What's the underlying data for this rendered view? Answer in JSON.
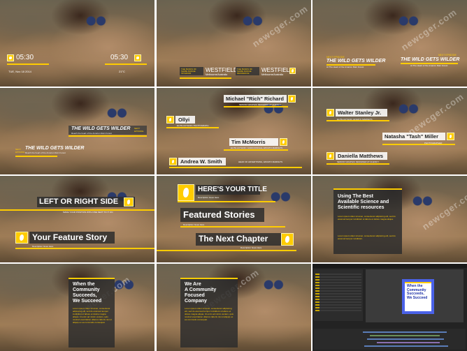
{
  "watermark": "newcger.com",
  "tiles": {
    "t1": {
      "left_time": "05:30",
      "right_time": "05:30",
      "left_date": "TUE, Nov 18 2014",
      "right_temp": "21°C"
    },
    "t2": {
      "left_block": "THE BANKS OF\nSHIRE RANGE\nINTERIOR",
      "left_name": "WESTFIELD",
      "left_sub": "Melbourne/Australia",
      "right_block": "THE BANKS OF\nSHIRE RANGE\nRESIDENCE",
      "right_name": "WESTFIELD",
      "right_sub": "Melbourne/Australia"
    },
    "t3": {
      "kicker": "NEXT EPISODE",
      "title": "THE WILD GETS WILDER",
      "sub": "At The Heart of the Amazon Rain Forest",
      "kicker2": "NEXT EPISODE",
      "title2": "THE WILD GETS WILDER",
      "sub2": "At The Heart of the Amazon Rain Forest"
    },
    "t4": {
      "title_a": "THE WILD GETS WILDER",
      "sub_a": "Reach the heart of the Amazon Rain Forest",
      "side_a": "NEXT\nEPISODE",
      "title_b": "THE WILD GETS WILDER",
      "sub_b": "Reach the heart of the Amazon Rain Forest",
      "side_b": "NEXT\nEPISODE"
    },
    "t5": {
      "name1": "Michael \"Rich\" Richard",
      "role1": "SENIOR GRAPHIC DESIGNER AT AGENCY",
      "name2": "Ollyi",
      "role2": "ELITE AUTHOR / PHOTOGRAPH",
      "name3": "Tim McMorris",
      "role3": "ELITE AUTHOR / AUDIOJUNGLE, ENVATO MARKETS",
      "name4": "Andrea W. Smith",
      "role4": "HEAD OF ADVERTISING, ENVATO MARKETS"
    },
    "t6": {
      "name1": "Walter Stanley Jr.",
      "role1": "ELITE AUTHOR, ENVATO MARKETS",
      "name2": "Natasha \"Tash\" Miller",
      "role2": "PHOTOGRAPHER",
      "name3": "Daniella Matthews",
      "role3": "SENIOR GRAPHIC DESIGNER AT AGENCY"
    },
    "t7": {
      "title1": "LEFT OR RIGHT SIDE",
      "sub1": "MAKE YOUR POSITION WITH ONE NEXT TO IT ON",
      "title2": "Your Feature Story",
      "sub2": "Description Goes Here"
    },
    "t8": {
      "title1": "HERE'S YOUR TITLE",
      "sub1": "Description Goes Here",
      "title2": "Featured Stories",
      "sub2": "Description Goes Here",
      "title3": "The Next Chapter",
      "sub3": "Description Goes Here"
    },
    "t9": {
      "heading": "Using The Best\nAvailable Science and\nScientific resources",
      "body1": "Lorem ipsum dolor sit amet, consectetur adipiscing elit, sed do eiusmod tempor incididunt ut labore et dolore magna aliqua.",
      "body2": "Lorem ipsum dolor sit amet, consectetur adipiscing elit, sed do eiusmod tempor incididunt."
    },
    "t10": {
      "heading": "When the\nCommunity\nSucceeds,\nWe Succeed",
      "body": "Lorem ipsum dolor sit amet, consectetur adipiscing elit, sed do eiusmod tempor incididunt ut labore et dolore magna aliqua. Ut enim ad minim veniam, quis nostrud exercitation ullamco laboris nisi ut aliquip ex ea commodo consequat."
    },
    "t11": {
      "heading": "We Are\nA Community\nFocused\nCompany",
      "body": "Lorem ipsum dolor sit amet, consectetur adipiscing elit, sed do eiusmod tempor incididunt ut labore et dolore magna aliqua. Ut enim ad minim veniam, quis nostrud exercitation ullamco laboris nisi ut aliquip ex ea commodo consequat."
    },
    "t12": {
      "comp_heading": "When the\nCommunity\nSucceeds,\nWe Succeed"
    }
  },
  "colors": {
    "accent": "#ffcc00",
    "dark_box": "#2a2a2a",
    "ae_bg": "#232323",
    "ae_comp": "#4a62e8"
  }
}
